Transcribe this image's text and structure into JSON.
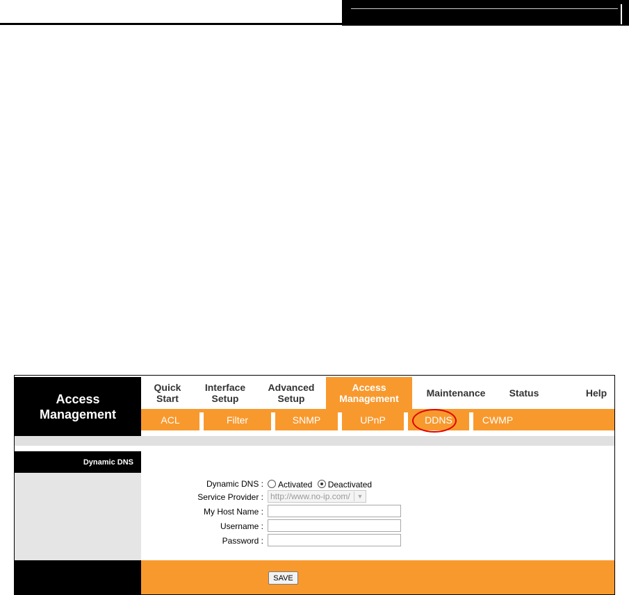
{
  "brand": {
    "line1": "Access",
    "line2": "Management"
  },
  "main_nav": [
    {
      "line1": "Quick",
      "line2": "Start"
    },
    {
      "line1": "Interface",
      "line2": "Setup"
    },
    {
      "line1": "Advanced",
      "line2": "Setup"
    },
    {
      "line1": "Access",
      "line2": "Management",
      "active": true
    },
    {
      "line1": "Maintenance"
    },
    {
      "line1": "Status"
    },
    {
      "line1": "Help"
    }
  ],
  "sub_nav": [
    "ACL",
    "Filter",
    "SNMP",
    "UPnP",
    "DDNS",
    "CWMP"
  ],
  "sub_nav_active": "DDNS",
  "section": {
    "label": "Dynamic DNS"
  },
  "form": {
    "dynamic_dns": {
      "label": "Dynamic DNS :",
      "options": [
        "Activated",
        "Deactivated"
      ],
      "selected": "Deactivated"
    },
    "service_provider": {
      "label": "Service Provider :",
      "value": "http://www.no-ip.com/"
    },
    "host_name": {
      "label": "My Host Name :",
      "value": ""
    },
    "username": {
      "label": "Username :",
      "value": ""
    },
    "password": {
      "label": "Password :",
      "value": ""
    }
  },
  "buttons": {
    "save": "SAVE"
  },
  "colors": {
    "accent": "#f8992e",
    "highlight_circle": "#e00000"
  }
}
